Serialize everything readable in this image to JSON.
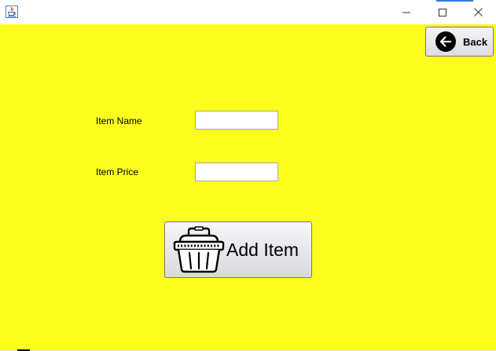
{
  "window": {
    "title": "",
    "app_icon": "java-cup-icon",
    "controls": {
      "minimize_icon": "minimize-icon",
      "maximize_icon": "maximize-icon",
      "close_icon": "close-icon"
    }
  },
  "colors": {
    "background": "#fcfc1e",
    "titlebar": "#ffffff",
    "button_face": "#e8e8ec"
  },
  "back_button": {
    "label": "Back",
    "icon": "arrow-left-circle-icon"
  },
  "form": {
    "item_name": {
      "label": "Item Name",
      "value": ""
    },
    "item_price": {
      "label": "Item Price",
      "value": ""
    }
  },
  "add_button": {
    "label": "Add Item",
    "icon": "basket-icon"
  }
}
